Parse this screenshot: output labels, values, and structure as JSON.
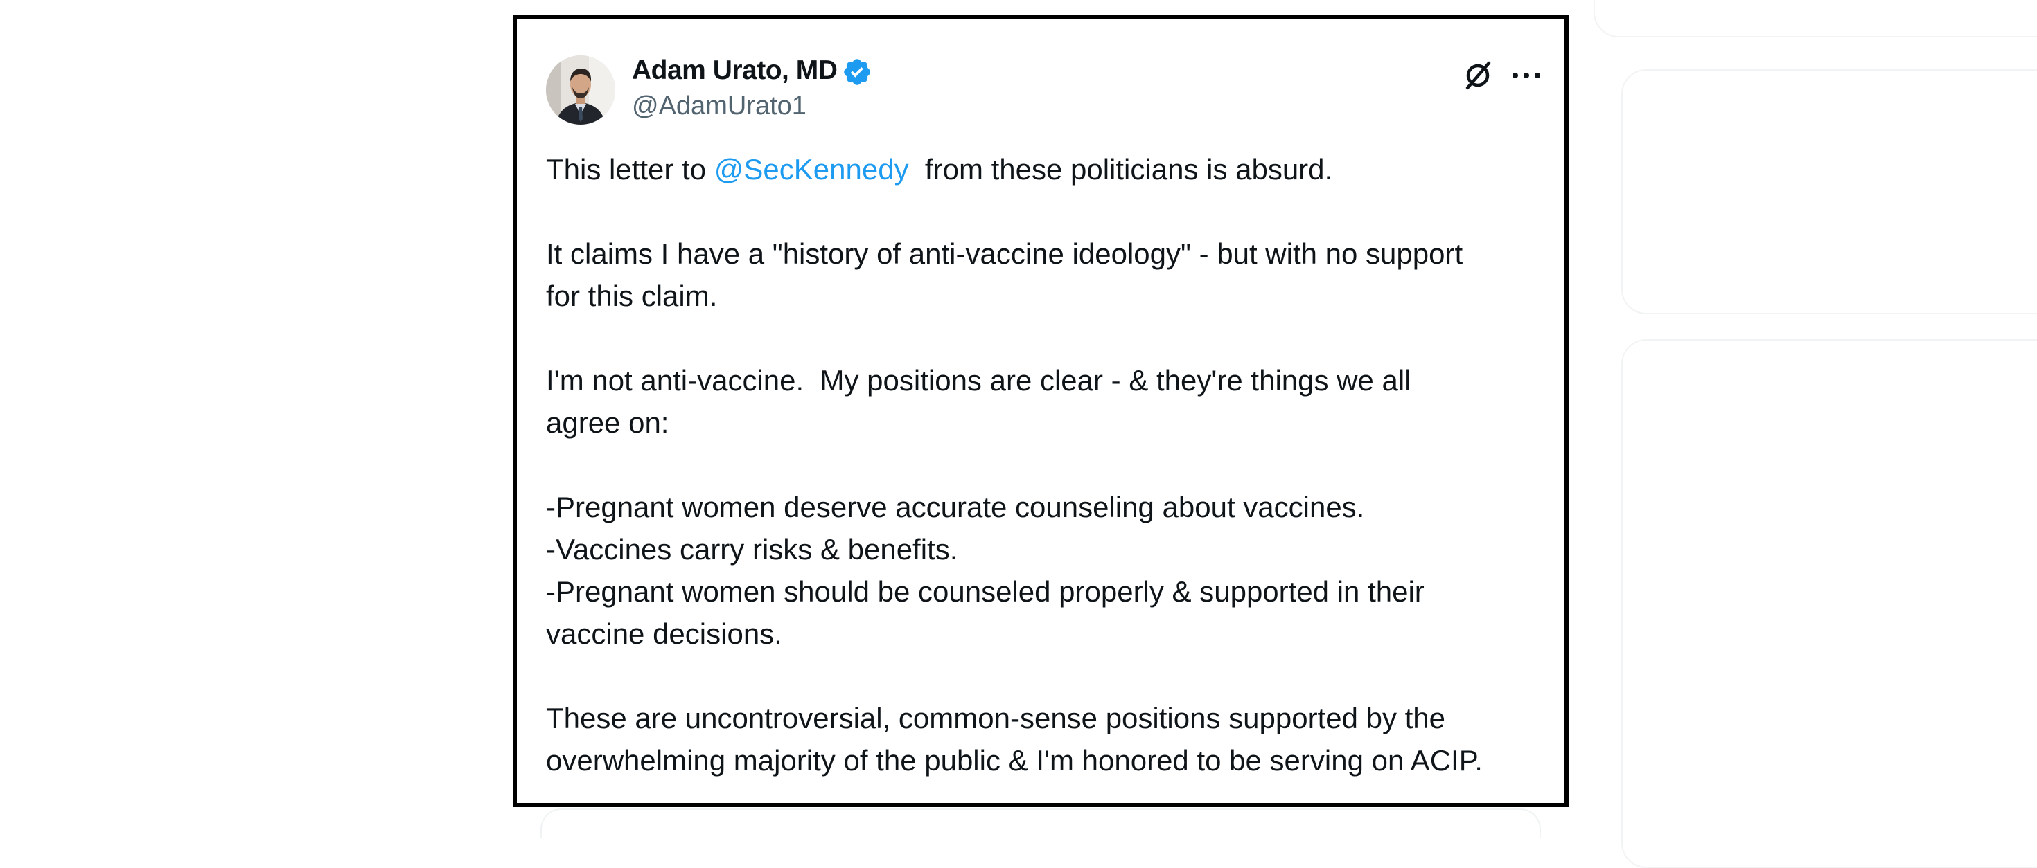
{
  "post": {
    "author": {
      "name": "Adam Urato, MD",
      "handle": "@AdamUrato1",
      "verified": true,
      "verified_color": "#1d9bf0",
      "avatar_icon": "avatar-photo"
    },
    "actions": {
      "grok_icon": "grok-icon",
      "more_icon": "more-icon"
    },
    "text": {
      "line1_prefix": "This letter to ",
      "mention": "@SecKennedy",
      "line1_suffix": "  from these politicians is absurd.",
      "para2_line1": "It claims I have a \"history of anti-vaccine ideology\" - but with no support",
      "para2_line2": "for this claim.",
      "para3_line1": "I'm not anti-vaccine.  My positions are clear - & they're things we all",
      "para3_line2": "agree on:",
      "bullet1": "-Pregnant women deserve accurate counseling about vaccines.",
      "bullet2": "-Vaccines carry risks & benefits.",
      "bullet3_line1": "-Pregnant women should be counseled properly & supported in their",
      "bullet3_line2": "vaccine decisions.",
      "para5_line1": "These are uncontroversial, common-sense positions supported by the",
      "para5_line2": "overwhelming majority of the public & I'm honored to be serving on ACIP."
    }
  },
  "colors": {
    "text": "#0f1419",
    "secondary": "#536471",
    "link": "#1d9bf0",
    "card_border": "#000000"
  }
}
